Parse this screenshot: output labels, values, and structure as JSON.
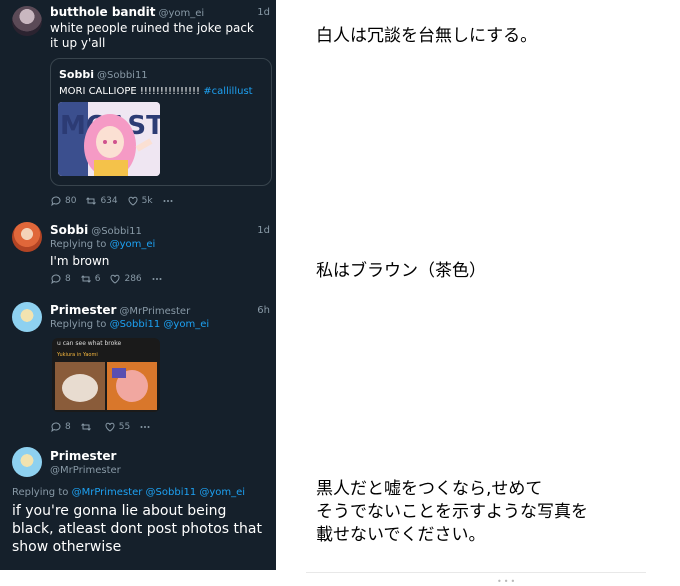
{
  "tweet1": {
    "name": "butthole bandit",
    "handle": "@yom_ei",
    "time": "1d",
    "text": "white people ruined the joke pack it up y'all",
    "quote": {
      "name": "Sobbi",
      "handle": "@Sobbi11",
      "text": "MORI CALLIOPE !!!!!!!!!!!!!!! ",
      "hashtag": "#callillust",
      "image_text": "MOAST"
    },
    "replies": "80",
    "retweets": "634",
    "likes": "5k"
  },
  "tweet2": {
    "name": "Sobbi",
    "handle": "@Sobbi11",
    "time": "1d",
    "replying_label": "Replying to",
    "replying_to": "@yom_ei",
    "text": "I'm brown",
    "replies": "8",
    "retweets": "6",
    "likes": "286"
  },
  "tweet3": {
    "name": "Primester",
    "handle": "@MrPrimester",
    "time": "6h",
    "replying_label": "Replying to",
    "replying_to": "@Sobbi11 @yom_ei",
    "image_caption1": "u can see what broke",
    "image_caption2": "Yukiura in Yaomi",
    "replies": "8",
    "retweets": "",
    "likes": "55"
  },
  "tweet4": {
    "name": "Primester",
    "handle": "@MrPrimester",
    "replying_label": "Replying to",
    "replying_to": "@MrPrimester @Sobbi11 @yom_ei",
    "text": "if you're gonna lie about being black, atleast dont post photos that show otherwise"
  },
  "japanese": {
    "line1": "白人は冗談を台無しにする。",
    "line2": "私はブラウン（茶色）",
    "line3a": "黒人だと嘘をつくなら,せめて",
    "line3b": " そうでないことを示すような写真を",
    "line3c": "載せないでください。"
  },
  "colors": {
    "bg": "#15202b",
    "accent": "#1da1f2",
    "muted": "#8899a6"
  },
  "icons": [
    "reply-icon",
    "retweet-icon",
    "like-icon",
    "more-icon"
  ]
}
